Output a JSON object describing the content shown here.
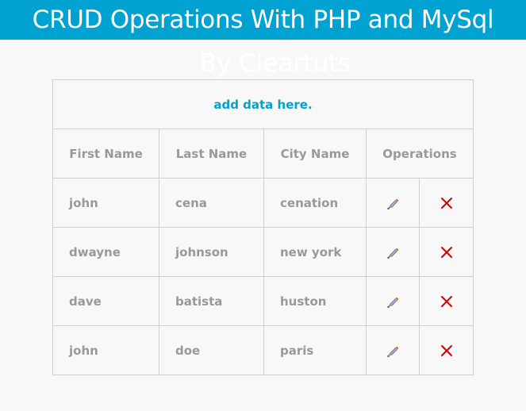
{
  "header": {
    "title": "CRUD Operations With PHP and MySql",
    "subtitle": "By Cleartuts",
    "accent_color": "#00a2d1"
  },
  "table": {
    "add_link": "add data here.",
    "columns": [
      "First Name",
      "Last Name",
      "City Name",
      "Operations"
    ],
    "rows": [
      {
        "first": "john",
        "last": "cena",
        "city": "cenation"
      },
      {
        "first": "dwayne",
        "last": "johnson",
        "city": "new york"
      },
      {
        "first": "dave",
        "last": "batista",
        "city": "huston"
      },
      {
        "first": "john",
        "last": "doe",
        "city": "paris"
      }
    ],
    "edit_icon": "pencil-icon",
    "delete_icon": "red-x-icon"
  }
}
